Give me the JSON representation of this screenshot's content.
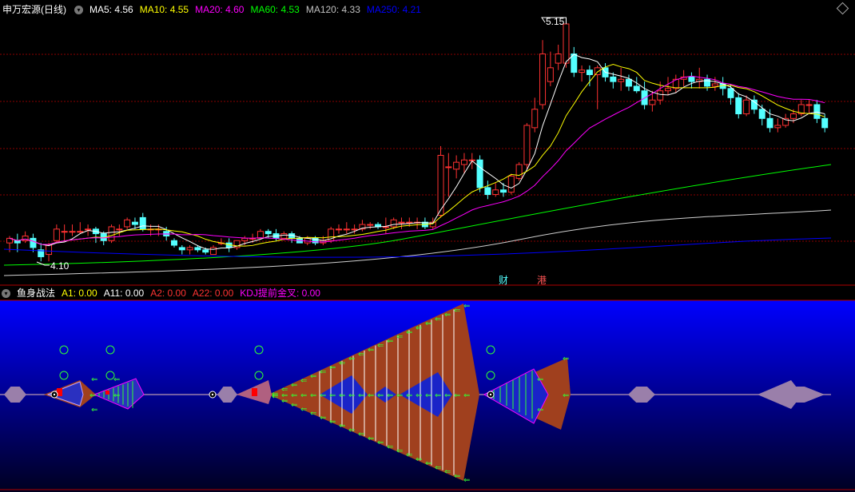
{
  "main_panel": {
    "title": "申万宏源(日线)",
    "ma_items": [
      {
        "label": "MA5: 4.56",
        "color": "#ffffff"
      },
      {
        "label": "MA10: 4.55",
        "color": "#ffff00"
      },
      {
        "label": "MA20: 4.60",
        "color": "#ff00ff"
      },
      {
        "label": "MA60: 4.53",
        "color": "#00ff00"
      },
      {
        "label": "MA120: 4.33",
        "color": "#c0c0c0"
      },
      {
        "label": "MA250: 4.21",
        "color": "#0000ff"
      }
    ],
    "high_label": "5.15",
    "low_label": "4.10",
    "markers": {
      "cai": "财",
      "gang": "港"
    }
  },
  "indicator_panel": {
    "title": "鱼身战法",
    "items": [
      {
        "label": "A1: 0.00",
        "color": "#ffff00"
      },
      {
        "label": "A11: 0.00",
        "color": "#ffffff"
      },
      {
        "label": "A2: 0.00",
        "color": "#ff3333"
      },
      {
        "label": "A22: 0.00",
        "color": "#ff3333"
      },
      {
        "label": "KDJ提前金叉: 0.00",
        "color": "#ff00ff"
      }
    ]
  },
  "colors": {
    "up": "#ff3232",
    "down": "#54ffff",
    "grid": "#8b0000",
    "fish": "#a0401e",
    "fish_grey": "#9a7faa",
    "arrow": "#32ff32",
    "panel_top": "#0000ff",
    "panel_bottom": "#000020"
  },
  "chart_data": {
    "type": "candlestick",
    "high": 5.15,
    "low": 4.1,
    "candles": [
      [
        4.2,
        4.22,
        4.16,
        4.23
      ],
      [
        4.21,
        4.2,
        4.16,
        4.24
      ],
      [
        4.21,
        4.23,
        4.2,
        4.25
      ],
      [
        4.22,
        4.18,
        4.16,
        4.24
      ],
      [
        4.17,
        4.14,
        4.12,
        4.2
      ],
      [
        4.15,
        4.19,
        4.12,
        4.2
      ],
      [
        4.21,
        4.26,
        4.2,
        4.28
      ],
      [
        4.25,
        4.25,
        4.21,
        4.28
      ],
      [
        4.25,
        4.25,
        4.23,
        4.28
      ],
      [
        4.25,
        4.25,
        4.24,
        4.29
      ],
      [
        4.26,
        4.26,
        4.23,
        4.28
      ],
      [
        4.26,
        4.24,
        4.2,
        4.27
      ],
      [
        4.24,
        4.21,
        4.19,
        4.25
      ],
      [
        4.21,
        4.27,
        4.2,
        4.28
      ],
      [
        4.26,
        4.26,
        4.23,
        4.28
      ],
      [
        4.27,
        4.3,
        4.26,
        4.31
      ],
      [
        4.29,
        4.28,
        4.26,
        4.31
      ],
      [
        4.31,
        4.26,
        4.25,
        4.33
      ],
      [
        4.26,
        4.26,
        4.23,
        4.28
      ],
      [
        4.26,
        4.26,
        4.23,
        4.28
      ],
      [
        4.25,
        4.23,
        4.21,
        4.27
      ],
      [
        4.21,
        4.19,
        4.18,
        4.22
      ],
      [
        4.18,
        4.17,
        4.15,
        4.19
      ],
      [
        4.17,
        4.18,
        4.15,
        4.19
      ],
      [
        4.18,
        4.17,
        4.16,
        4.19
      ],
      [
        4.17,
        4.16,
        4.15,
        4.18
      ],
      [
        4.15,
        4.18,
        4.15,
        4.19
      ],
      [
        4.2,
        4.2,
        4.19,
        4.22
      ],
      [
        4.2,
        4.18,
        4.16,
        4.22
      ],
      [
        4.18,
        4.21,
        4.17,
        4.21
      ],
      [
        4.21,
        4.22,
        4.19,
        4.23
      ],
      [
        4.22,
        4.22,
        4.2,
        4.24
      ],
      [
        4.22,
        4.25,
        4.22,
        4.26
      ],
      [
        4.25,
        4.24,
        4.22,
        4.26
      ],
      [
        4.24,
        4.22,
        4.21,
        4.26
      ],
      [
        4.22,
        4.24,
        4.21,
        4.25
      ],
      [
        4.24,
        4.22,
        4.2,
        4.25
      ],
      [
        4.22,
        4.2,
        4.2,
        4.23
      ],
      [
        4.2,
        4.22,
        4.19,
        4.23
      ],
      [
        4.22,
        4.2,
        4.19,
        4.23
      ],
      [
        4.2,
        4.21,
        4.19,
        4.23
      ],
      [
        4.21,
        4.26,
        4.2,
        4.27
      ],
      [
        4.26,
        4.26,
        4.24,
        4.28
      ],
      [
        4.26,
        4.26,
        4.24,
        4.29
      ],
      [
        4.26,
        4.26,
        4.24,
        4.28
      ],
      [
        4.26,
        4.28,
        4.25,
        4.3
      ],
      [
        4.28,
        4.28,
        4.26,
        4.29
      ],
      [
        4.28,
        4.27,
        4.26,
        4.29
      ],
      [
        4.27,
        4.27,
        4.24,
        4.31
      ],
      [
        4.27,
        4.3,
        4.26,
        4.31
      ],
      [
        4.29,
        4.29,
        4.26,
        4.31
      ],
      [
        4.29,
        4.29,
        4.27,
        4.31
      ],
      [
        4.29,
        4.29,
        4.26,
        4.31
      ],
      [
        4.29,
        4.27,
        4.26,
        4.31
      ],
      [
        4.27,
        4.29,
        4.26,
        4.31
      ],
      [
        4.32,
        4.58,
        4.31,
        4.62
      ],
      [
        4.53,
        4.53,
        4.4,
        4.59
      ],
      [
        4.52,
        4.55,
        4.48,
        4.58
      ],
      [
        4.54,
        4.56,
        4.5,
        4.59
      ],
      [
        4.56,
        4.56,
        4.52,
        4.59
      ],
      [
        4.56,
        4.44,
        4.42,
        4.58
      ],
      [
        4.44,
        4.41,
        4.39,
        4.47
      ],
      [
        4.41,
        4.43,
        4.4,
        4.46
      ],
      [
        4.43,
        4.42,
        4.4,
        4.46
      ],
      [
        4.42,
        4.49,
        4.41,
        4.5
      ],
      [
        4.48,
        4.54,
        4.47,
        4.55
      ],
      [
        4.54,
        4.71,
        4.52,
        4.72
      ],
      [
        4.7,
        4.78,
        4.68,
        4.83
      ],
      [
        4.8,
        5.02,
        4.78,
        5.08
      ],
      [
        4.9,
        4.96,
        4.88,
        5.03
      ],
      [
        4.98,
        5.02,
        4.95,
        5.06
      ],
      [
        4.98,
        5.15,
        4.96,
        5.15
      ],
      [
        5.02,
        4.94,
        4.92,
        5.05
      ],
      [
        4.94,
        4.95,
        4.9,
        4.97
      ],
      [
        4.95,
        4.93,
        4.88,
        4.97
      ],
      [
        4.93,
        4.96,
        4.78,
        4.97
      ],
      [
        4.96,
        4.92,
        4.9,
        4.98
      ],
      [
        4.92,
        4.9,
        4.87,
        4.94
      ],
      [
        4.9,
        4.91,
        4.86,
        4.96
      ],
      [
        4.91,
        4.88,
        4.86,
        4.93
      ],
      [
        4.88,
        4.86,
        4.85,
        4.92
      ],
      [
        4.86,
        4.8,
        4.78,
        4.9
      ],
      [
        4.8,
        4.82,
        4.77,
        4.86
      ],
      [
        4.82,
        4.86,
        4.8,
        4.9
      ],
      [
        4.86,
        4.87,
        4.84,
        4.92
      ],
      [
        4.87,
        4.91,
        4.85,
        4.93
      ],
      [
        4.91,
        4.92,
        4.88,
        4.95
      ],
      [
        4.92,
        4.9,
        4.87,
        4.94
      ],
      [
        4.9,
        4.91,
        4.87,
        4.96
      ],
      [
        4.91,
        4.88,
        4.86,
        4.93
      ],
      [
        4.88,
        4.89,
        4.86,
        4.92
      ],
      [
        4.89,
        4.87,
        4.84,
        4.92
      ],
      [
        4.87,
        4.83,
        4.8,
        4.89
      ],
      [
        4.83,
        4.76,
        4.74,
        4.85
      ],
      [
        4.76,
        4.82,
        4.75,
        4.84
      ],
      [
        4.82,
        4.78,
        4.76,
        4.84
      ],
      [
        4.78,
        4.74,
        4.71,
        4.8
      ],
      [
        4.74,
        4.7,
        4.68,
        4.78
      ],
      [
        4.7,
        4.71,
        4.68,
        4.74
      ],
      [
        4.71,
        4.74,
        4.7,
        4.76
      ],
      [
        4.74,
        4.76,
        4.72,
        4.78
      ],
      [
        4.76,
        4.8,
        4.75,
        4.82
      ],
      [
        4.8,
        4.8,
        4.76,
        4.82
      ],
      [
        4.8,
        4.74,
        4.72,
        4.82
      ],
      [
        4.74,
        4.7,
        4.68,
        4.76
      ]
    ]
  }
}
